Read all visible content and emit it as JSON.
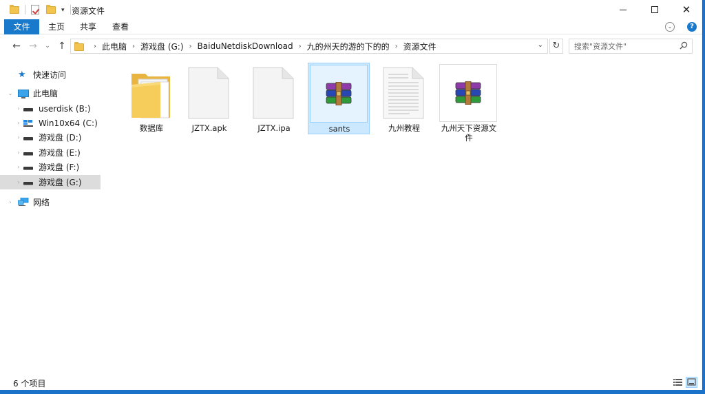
{
  "window": {
    "title": "资源文件"
  },
  "ribbon": {
    "tabs": [
      "文件",
      "主页",
      "共享",
      "查看"
    ]
  },
  "address": {
    "crumbs": [
      "此电脑",
      "游戏盘 (G:)",
      "BaiduNetdiskDownload",
      "九的州天的游的下的的",
      "资源文件"
    ]
  },
  "search": {
    "placeholder": "搜索\"资源文件\""
  },
  "sidebar": {
    "items": [
      {
        "label": "快速访问",
        "icon": "star-icon"
      },
      {
        "label": "此电脑",
        "icon": "computer-icon"
      },
      {
        "label": "userdisk (B:)",
        "icon": "drive-icon"
      },
      {
        "label": "Win10x64 (C:)",
        "icon": "windows-drive-icon"
      },
      {
        "label": "游戏盘 (D:)",
        "icon": "drive-icon"
      },
      {
        "label": "游戏盘 (E:)",
        "icon": "drive-icon"
      },
      {
        "label": "游戏盘 (F:)",
        "icon": "drive-icon"
      },
      {
        "label": "游戏盘 (G:)",
        "icon": "drive-icon"
      },
      {
        "label": "网络",
        "icon": "network-icon"
      }
    ]
  },
  "files": [
    {
      "name": "数据库",
      "type": "folder"
    },
    {
      "name": "JZTX.apk",
      "type": "blank-file"
    },
    {
      "name": "JZTX.ipa",
      "type": "blank-file"
    },
    {
      "name": "sants",
      "type": "rar-archive"
    },
    {
      "name": "九州教程",
      "type": "text-document"
    },
    {
      "name": "九州天下资源文件",
      "type": "rar-archive"
    }
  ],
  "status": {
    "text": "6 个项目"
  },
  "colors": {
    "accent": "#1979ca",
    "selection": "#cce8ff",
    "folder": "#f3c54f"
  }
}
